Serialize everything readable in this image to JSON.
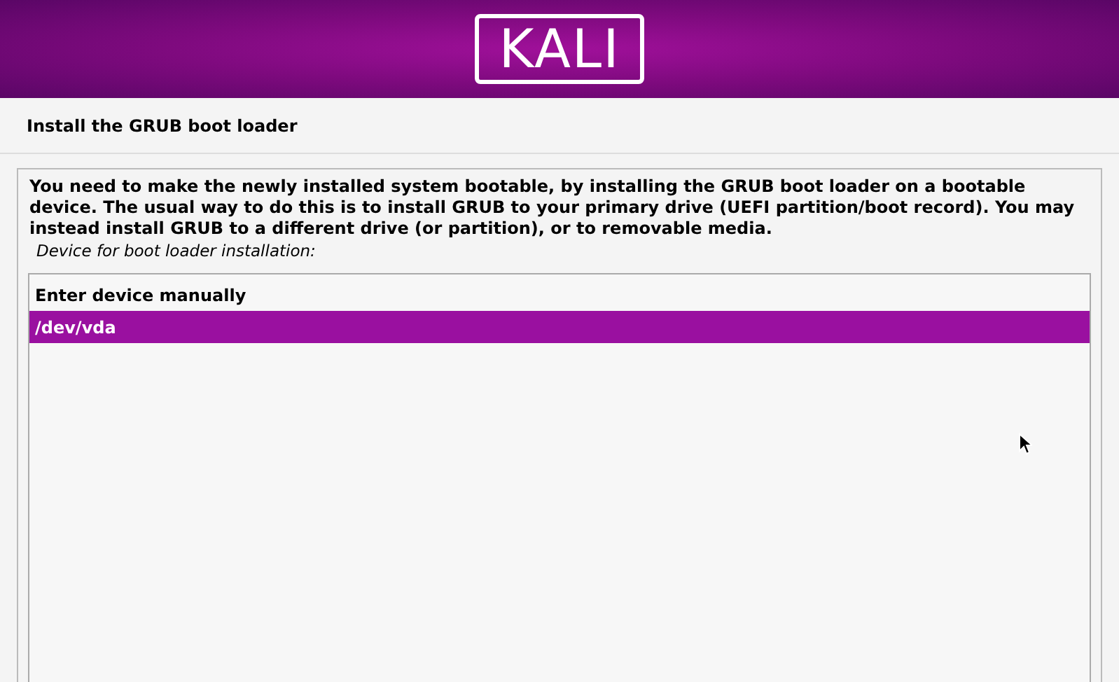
{
  "header": {
    "logo": "KALI"
  },
  "title": "Install the GRUB boot loader",
  "description": "You need to make the newly installed system bootable, by installing the GRUB boot loader on a bootable device. The usual way to do this is to install GRUB to your primary drive (UEFI partition/boot record). You may instead install GRUB to a different drive (or partition), or to removable media.",
  "list_label": "Device for boot loader installation:",
  "devices": [
    {
      "label": "Enter device manually",
      "selected": false
    },
    {
      "label": "/dev/vda",
      "selected": true
    }
  ]
}
